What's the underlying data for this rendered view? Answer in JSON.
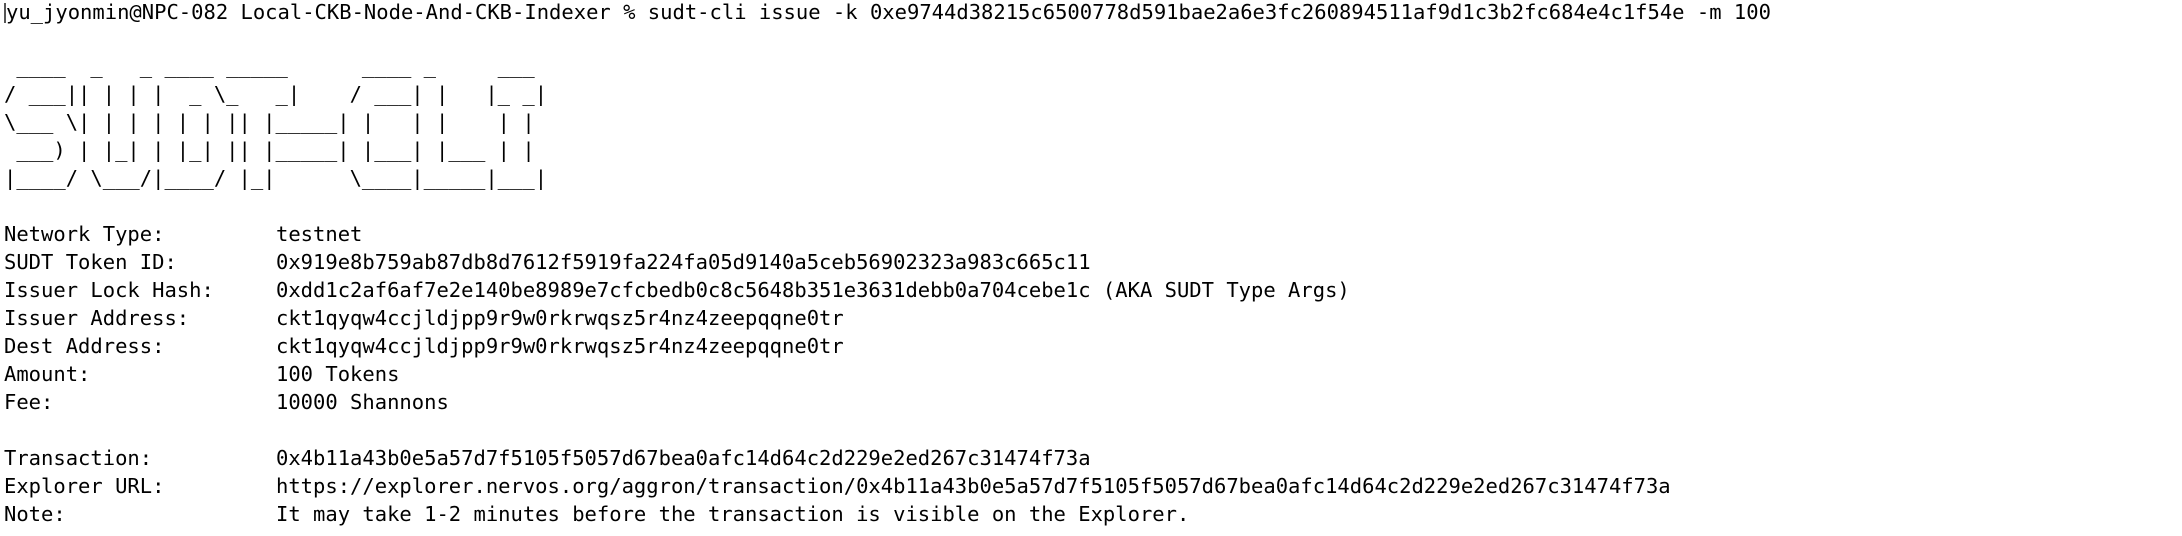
{
  "terminal": {
    "prompt": "yu_jyonmin@NPC-082 Local-CKB-Node-And-CKB-Indexer % ",
    "command": "sudt-cli issue -k 0xe9744d38215c6500778d591bae2a6e3fc260894511af9d1c3b2fc684e4c1f54e -m 100",
    "banner": " ____  _   _ ____ _____      ____ _     ___ \n/ ___|| | | |  _ \\_   _|    / ___| |   |_ _|\n\\___ \\| | | | | | || |_____| |   | |    | | \n ___) | |_| | |_| || |_____| |___| |___ | | \n|____/ \\___/|____/ |_|      \\____|_____|___|",
    "info": [
      {
        "label": "Network Type:",
        "value": "testnet"
      },
      {
        "label": "SUDT Token ID:",
        "value": "0x919e8b759ab87db8d7612f5919fa224fa05d9140a5ceb56902323a983c665c11"
      },
      {
        "label": "Issuer Lock Hash:",
        "value": "0xdd1c2af6af7e2e140be8989e7cfcbedb0c8c5648b351e3631debb0a704cebe1c (AKA SUDT Type Args)"
      },
      {
        "label": "Issuer Address:",
        "value": "ckt1qyqw4ccjldjpp9r9w0rkrwqsz5r4nz4zeepqqne0tr"
      },
      {
        "label": "Dest Address:",
        "value": "ckt1qyqw4ccjldjpp9r9w0rkrwqsz5r4nz4zeepqqne0tr"
      },
      {
        "label": "Amount:",
        "value": "100 Tokens"
      },
      {
        "label": "Fee:",
        "value": "10000 Shannons"
      }
    ],
    "result": [
      {
        "label": "Transaction:",
        "value": "0x4b11a43b0e5a57d7f5105f5057d67bea0afc14d64c2d229e2ed267c31474f73a"
      },
      {
        "label": "Explorer URL:",
        "value": "https://explorer.nervos.org/aggron/transaction/0x4b11a43b0e5a57d7f5105f5057d67bea0afc14d64c2d229e2ed267c31474f73a"
      },
      {
        "label": "Note:",
        "value": "It may take 1-2 minutes before the transaction is visible on the Explorer."
      }
    ]
  }
}
